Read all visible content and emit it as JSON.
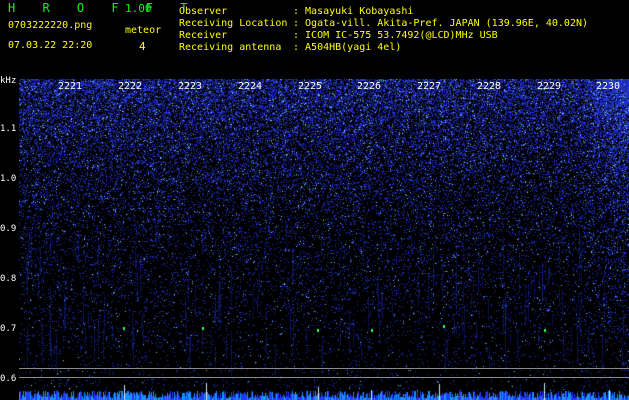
{
  "header": {
    "app_letters": "H R O F F T",
    "version": "1.00",
    "filename": "0703222220.png",
    "datetime": "07.03.22 22:20",
    "meteor_label": "meteor",
    "meteor_count": "4"
  },
  "info": {
    "labels": "Observer\nReceiving Location\nReceiver\nReceiving antenna",
    "values": ": Masayuki Kobayashi\n: Ogata-vill. Akita-Pref. JAPAN (139.96E, 40.02N)\n: ICOM IC-575 53.7492(@LCD)MHz USB\n: A504HB(yagi 4el)"
  },
  "freq_axis": {
    "unit": "kHz",
    "ticks": [
      "1.1",
      "1.0",
      "0.9",
      "0.8",
      "0.7",
      "0.6"
    ]
  },
  "time_axis": {
    "ticks": [
      "2221",
      "2222",
      "2223",
      "2224",
      "2225",
      "2226",
      "2227",
      "2228",
      "2229",
      "2230"
    ]
  },
  "colors": {
    "text_green": "#00ff00",
    "text_yellow": "#ffff00",
    "noise": "#1a30ff",
    "signal": "#00e0ff",
    "background": "#000000"
  }
}
